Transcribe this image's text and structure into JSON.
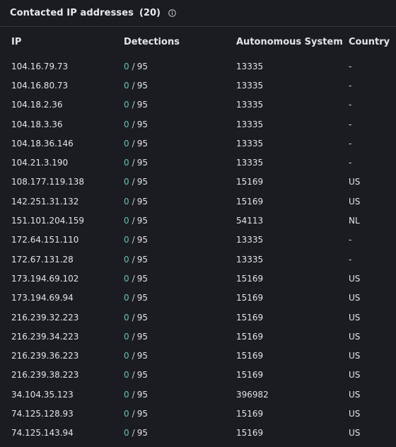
{
  "header": {
    "title": "Contacted IP addresses",
    "count": "(20)",
    "info_icon": "info-circle-icon"
  },
  "columns": {
    "ip": "IP",
    "detections": "Detections",
    "as": "Autonomous System",
    "country": "Country"
  },
  "rows": [
    {
      "ip": "104.16.79.73",
      "det": "0",
      "sep": "/",
      "total": "95",
      "as": "13335",
      "country": "-"
    },
    {
      "ip": "104.16.80.73",
      "det": "0",
      "sep": "/",
      "total": "95",
      "as": "13335",
      "country": "-"
    },
    {
      "ip": "104.18.2.36",
      "det": "0",
      "sep": "/",
      "total": "95",
      "as": "13335",
      "country": "-"
    },
    {
      "ip": "104.18.3.36",
      "det": "0",
      "sep": "/",
      "total": "95",
      "as": "13335",
      "country": "-"
    },
    {
      "ip": "104.18.36.146",
      "det": "0",
      "sep": "/",
      "total": "95",
      "as": "13335",
      "country": "-"
    },
    {
      "ip": "104.21.3.190",
      "det": "0",
      "sep": "/",
      "total": "95",
      "as": "13335",
      "country": "-"
    },
    {
      "ip": "108.177.119.138",
      "det": "0",
      "sep": "/",
      "total": "95",
      "as": "15169",
      "country": "US"
    },
    {
      "ip": "142.251.31.132",
      "det": "0",
      "sep": "/",
      "total": "95",
      "as": "15169",
      "country": "US"
    },
    {
      "ip": "151.101.204.159",
      "det": "0",
      "sep": "/",
      "total": "95",
      "as": "54113",
      "country": "NL"
    },
    {
      "ip": "172.64.151.110",
      "det": "0",
      "sep": "/",
      "total": "95",
      "as": "13335",
      "country": "-"
    },
    {
      "ip": "172.67.131.28",
      "det": "0",
      "sep": "/",
      "total": "95",
      "as": "13335",
      "country": "-"
    },
    {
      "ip": "173.194.69.102",
      "det": "0",
      "sep": "/",
      "total": "95",
      "as": "15169",
      "country": "US"
    },
    {
      "ip": "173.194.69.94",
      "det": "0",
      "sep": "/",
      "total": "95",
      "as": "15169",
      "country": "US"
    },
    {
      "ip": "216.239.32.223",
      "det": "0",
      "sep": "/",
      "total": "95",
      "as": "15169",
      "country": "US"
    },
    {
      "ip": "216.239.34.223",
      "det": "0",
      "sep": "/",
      "total": "95",
      "as": "15169",
      "country": "US"
    },
    {
      "ip": "216.239.36.223",
      "det": "0",
      "sep": "/",
      "total": "95",
      "as": "15169",
      "country": "US"
    },
    {
      "ip": "216.239.38.223",
      "det": "0",
      "sep": "/",
      "total": "95",
      "as": "15169",
      "country": "US"
    },
    {
      "ip": "34.104.35.123",
      "det": "0",
      "sep": "/",
      "total": "95",
      "as": "396982",
      "country": "US"
    },
    {
      "ip": "74.125.128.93",
      "det": "0",
      "sep": "/",
      "total": "95",
      "as": "15169",
      "country": "US"
    },
    {
      "ip": "74.125.143.94",
      "det": "0",
      "sep": "/",
      "total": "95",
      "as": "15169",
      "country": "US"
    }
  ],
  "colors": {
    "background": "#1b1c22",
    "detection_zero": "#5fc6b4",
    "text": "#e3e4e8"
  }
}
